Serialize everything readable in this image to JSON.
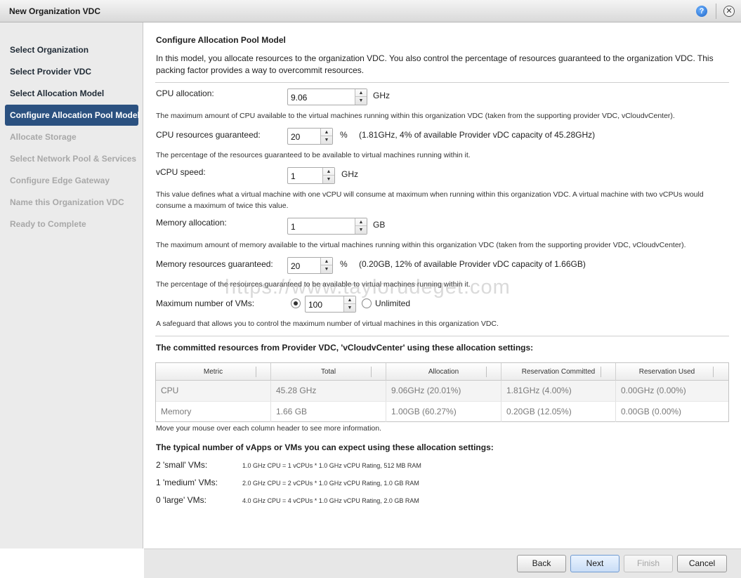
{
  "window": {
    "title": "New Organization VDC"
  },
  "sidebar": {
    "items": [
      {
        "label": "Select Organization",
        "state": "done"
      },
      {
        "label": "Select Provider VDC",
        "state": "done"
      },
      {
        "label": "Select Allocation Model",
        "state": "done"
      },
      {
        "label": "Configure Allocation Pool Model",
        "state": "active"
      },
      {
        "label": "Allocate Storage",
        "state": "todo"
      },
      {
        "label": "Select Network Pool & Services",
        "state": "todo"
      },
      {
        "label": "Configure Edge Gateway",
        "state": "todo"
      },
      {
        "label": "Name this Organization VDC",
        "state": "todo"
      },
      {
        "label": "Ready to Complete",
        "state": "todo"
      }
    ]
  },
  "main": {
    "heading": "Configure Allocation Pool Model",
    "intro": "In this model, you allocate resources to the organization VDC. You also control the percentage of resources guaranteed to the organization VDC. This packing factor provides a way to overcommit resources.",
    "cpu_allocation": {
      "label": "CPU allocation:",
      "value": "9.06",
      "unit": "GHz",
      "help": "The maximum amount of CPU available to the virtual machines running within this organization VDC (taken from the supporting provider VDC, vCloudvCenter)."
    },
    "cpu_guaranteed": {
      "label": "CPU resources guaranteed:",
      "value": "20",
      "unit": "%",
      "note": "(1.81GHz, 4% of available Provider vDC capacity of 45.28GHz)",
      "help": "The percentage of the resources guaranteed to be available to virtual machines running within it."
    },
    "vcpu_speed": {
      "label": "vCPU speed:",
      "value": "1",
      "unit": "GHz",
      "help": "This value defines what a virtual machine with one vCPU will consume at maximum when running within this organization VDC. A virtual machine with two vCPUs would consume a maximum of twice this value."
    },
    "memory_allocation": {
      "label": "Memory allocation:",
      "value": "1",
      "unit": "GB",
      "help": "The maximum amount of memory available to the virtual machines running within this organization VDC (taken from the supporting provider VDC, vCloudvCenter)."
    },
    "memory_guaranteed": {
      "label": "Memory resources guaranteed:",
      "value": "20",
      "unit": "%",
      "note": "(0.20GB, 12% of available Provider vDC capacity of 1.66GB)",
      "help": "The percentage of the resources guaranteed to be available to virtual machines running within it."
    },
    "max_vms": {
      "label": "Maximum number of VMs:",
      "value": "100",
      "unlimited_label": "Unlimited",
      "help": "A safeguard that allows you to control the maximum number of virtual machines in this organization VDC."
    },
    "watermark": "https://www.taylorudeget.com",
    "committed": {
      "heading": "The committed resources from Provider VDC, 'vCloudvCenter' using these allocation settings:",
      "columns": [
        "Metric",
        "Total",
        "Allocation",
        "Reservation Committed",
        "Reservation Used"
      ],
      "rows": [
        [
          "CPU",
          "45.28 GHz",
          "9.06GHz (20.01%)",
          "1.81GHz (4.00%)",
          "0.00GHz (0.00%)"
        ],
        [
          "Memory",
          "1.66 GB",
          "1.00GB (60.27%)",
          "0.20GB (12.05%)",
          "0.00GB (0.00%)"
        ]
      ],
      "hint": "Move your mouse over each column header to see more information."
    },
    "typical": {
      "heading": "The typical number of vApps or VMs you can expect using these allocation settings:",
      "rows": [
        {
          "label": "2 'small' VMs:",
          "detail": "1.0 GHz CPU = 1 vCPUs * 1.0 GHz vCPU Rating, 512 MB RAM"
        },
        {
          "label": "1 'medium' VMs:",
          "detail": "2.0 GHz CPU = 2 vCPUs * 1.0 GHz vCPU Rating, 1.0 GB RAM"
        },
        {
          "label": "0 'large' VMs:",
          "detail": "4.0 GHz CPU = 4 vCPUs * 1.0 GHz vCPU Rating, 2.0 GB RAM"
        }
      ]
    }
  },
  "footer": {
    "back": "Back",
    "next": "Next",
    "finish": "Finish",
    "cancel": "Cancel"
  }
}
